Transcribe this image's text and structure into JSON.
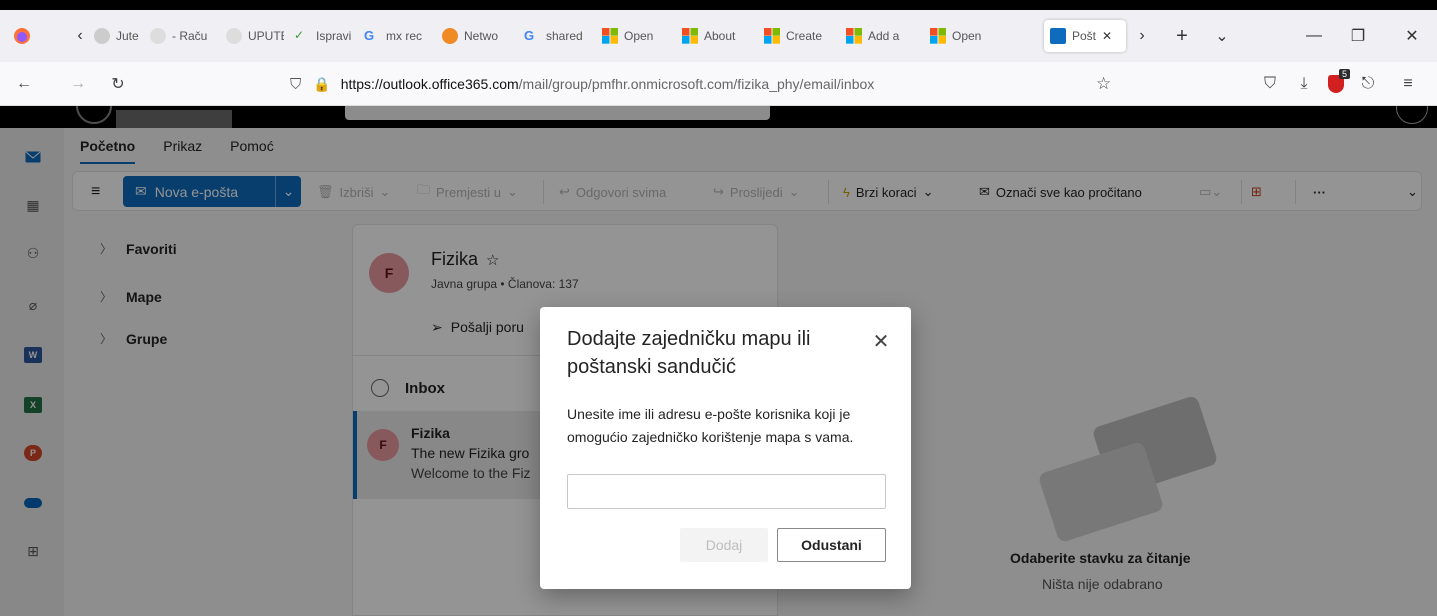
{
  "browser": {
    "tabs": [
      {
        "label": "Jute",
        "icon": "firefox-icon"
      },
      {
        "label": "- Raču",
        "icon": "blank-icon"
      },
      {
        "label": "UPUTE ZA",
        "icon": "blank-icon"
      },
      {
        "label": "Ispravi",
        "icon": "checkmark-icon"
      },
      {
        "label": "mx rec",
        "icon": "google-icon"
      },
      {
        "label": "Netwo",
        "icon": "network-icon"
      },
      {
        "label": "shared",
        "icon": "google-icon"
      },
      {
        "label": "Open",
        "icon": "microsoft-icon"
      },
      {
        "label": "About",
        "icon": "microsoft-icon"
      },
      {
        "label": "Create",
        "icon": "microsoft-icon"
      },
      {
        "label": "Add a",
        "icon": "microsoft-icon"
      },
      {
        "label": "Open",
        "icon": "microsoft-icon"
      },
      {
        "label": "Pošt",
        "icon": "outlook-icon",
        "active": true
      }
    ],
    "url_host": "https://outlook.office365.com",
    "url_path": "/mail/group/pmfhr.onmicrosoft.com/fizika_phy/email/inbox",
    "extension_badge": "5"
  },
  "outlook": {
    "ribbon_tabs": [
      "Početno",
      "Prikaz",
      "Pomoć"
    ],
    "ribbon": {
      "new_mail": "Nova e-pošta",
      "delete": "Izbriši",
      "move": "Premjesti u",
      "reply_all": "Odgovori svima",
      "forward": "Proslijedi",
      "quick_steps": "Brzi koraci",
      "mark_all_read": "Označi sve kao pročitano",
      "more": "···"
    },
    "folders": [
      "Favoriti",
      "Mape",
      "Grupe"
    ],
    "group": {
      "avatar_letter": "F",
      "name": "Fizika",
      "meta": "Javna grupa • Članova: 137",
      "send_message": "Pošalji poru"
    },
    "inbox_label": "Inbox",
    "message": {
      "avatar_letter": "F",
      "sender": "Fizika",
      "subject": "The new Fizika gro",
      "preview": "Welcome to the Fiz"
    },
    "reading_pane": {
      "title": "Odaberite stavku za čitanje",
      "subtitle": "Ništa nije odabrano"
    }
  },
  "dialog": {
    "title": "Dodajte zajedničku mapu ili poštanski sandučić",
    "description": "Unesite ime ili adresu e-pošte korisnika koji je omogućio zajedničko korištenje mapa s vama.",
    "input_value": "",
    "add_label": "Dodaj",
    "cancel_label": "Odustani"
  },
  "colors": {
    "accent": "#0f6cbd",
    "avatar": "#e89a9f"
  }
}
